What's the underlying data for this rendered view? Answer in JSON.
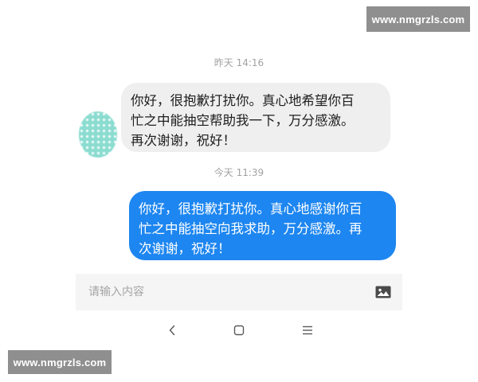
{
  "watermark": {
    "top": "www.nmgrzls.com",
    "bottom": "www.nmgrzls.com"
  },
  "chat": {
    "messages": [
      {
        "timestamp": "昨天 14:16",
        "direction": "incoming",
        "text": "你好，很抱歉打扰你。真心地希望你百\n忙之中能抽空帮助我一下，万分感激。\n再次谢谢，祝好！"
      },
      {
        "timestamp": "今天 11:39",
        "direction": "outgoing",
        "text": "你好，很抱歉打扰你。真心地感谢你百\n忙之中能抽空向我求助，万分感激。再\n次谢谢，祝好！"
      }
    ]
  },
  "composer": {
    "placeholder": "请输入内容",
    "value": "",
    "attach_icon": "image-icon"
  },
  "navigation": {
    "back_icon": "back-chevron-icon",
    "home_icon": "home-square-icon",
    "menu_icon": "menu-lines-icon"
  },
  "colors": {
    "incoming_bubble": "#efefef",
    "outgoing_bubble": "#1d86f0",
    "avatar": "#8bdcd0",
    "watermark_bg": "#8f8f8f"
  }
}
